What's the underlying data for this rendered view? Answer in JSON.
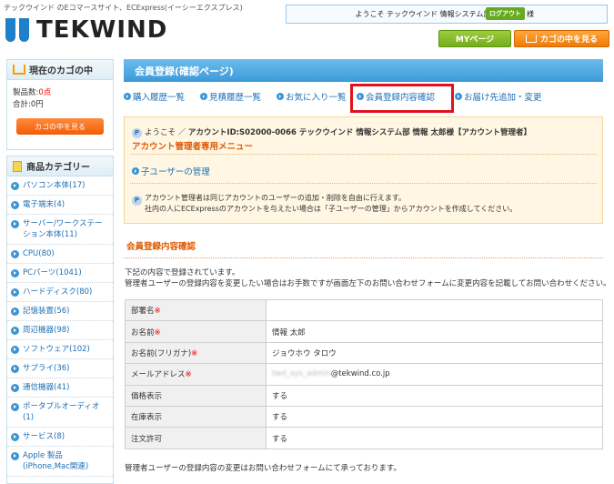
{
  "header": {
    "tagline": "テックウインド のEコマースサイト、ECExpress(イーシーエクスプレス)",
    "logo_text": "TEKWIND",
    "welcome_text": "ようこそ テックウインド 情報システム部 情報 太郎 様",
    "logout_label": "ログアウト",
    "my_page_label": "MYページ",
    "cart_label": "カゴの中を見る"
  },
  "sidebar": {
    "cart": {
      "title": "現在のカゴの中",
      "count_label": "製品数:",
      "count_value": "0点",
      "total_label": "合計:",
      "total_value": "0円",
      "button_label": "カゴの中を見る"
    },
    "categories": {
      "title": "商品カテゴリー",
      "items": [
        {
          "label": "パソコン本体(17)"
        },
        {
          "label": "電子端末(4)"
        },
        {
          "label": "サーバー/ワークステーション本体(11)"
        },
        {
          "label": "CPU(80)"
        },
        {
          "label": "PCパーツ(1041)"
        },
        {
          "label": "ハードディスク(80)"
        },
        {
          "label": "記憶装置(56)"
        },
        {
          "label": "周辺機器(98)"
        },
        {
          "label": "ソフトウェア(102)"
        },
        {
          "label": "サプライ(36)"
        },
        {
          "label": "通信機器(41)"
        },
        {
          "label": "ポータブルオーディオ(1)"
        },
        {
          "label": "サービス(8)"
        },
        {
          "label": "Apple 製品 (iPhone,Mac関連)"
        }
      ]
    }
  },
  "main": {
    "page_title": "会員登録(確認ページ)",
    "nav": {
      "purchase_history": "購入履歴一覧",
      "quote_history": "見積履歴一覧",
      "favorites": "お気に入り一覧",
      "member_info": "会員登録内容確認",
      "delivery": "お届け先追加・変更"
    },
    "admin": {
      "welcome": "ようこそ ／",
      "account": "アカウントID:S02000-0066 テックウインド 情報システム部 情報 太郎様【アカウント管理者】",
      "menu_title": "アカウント管理者専用メニュー",
      "child_user_link": "子ユーザーの管理",
      "note_line1": "アカウント管理者は同じアカウントのユーザーの追加・削除を自由に行えます。",
      "note_line2": "社内の人にECExpressのアカウントを与えたい場合は「子ユーザーの管理」からアカウントを作成してください。"
    },
    "section_title": "会員登録内容確認",
    "intro_line1": "下記の内容で登録されています。",
    "intro_line2": "管理者ユーザーの登録内容を変更したい場合はお手数ですが画面左下のお問い合わせフォームに変更内容を記載してお問い合わせください。",
    "table": {
      "department_label": "部署名",
      "department_value": "",
      "name_label": "お名前",
      "name_value": "情報 太郎",
      "kana_label": "お名前(フリガナ)",
      "kana_value": "ジョウホウ タロウ",
      "email_label": "メールアドレス",
      "email_hidden": "twd_sys_admin",
      "email_domain": "@tekwind.co.jp",
      "price_label": "価格表示",
      "price_value": "する",
      "stock_label": "在庫表示",
      "stock_value": "する",
      "order_label": "注文許可",
      "order_value": "する",
      "required_mark": "※"
    },
    "footer_note": "管理者ユーザーの登録内容の変更はお問い合わせフォームにて承っております。"
  },
  "colors": {
    "accent_blue": "#3b9ad9",
    "orange": "#f07a08",
    "green": "#74ad1c",
    "highlight_red": "#e2111b"
  }
}
